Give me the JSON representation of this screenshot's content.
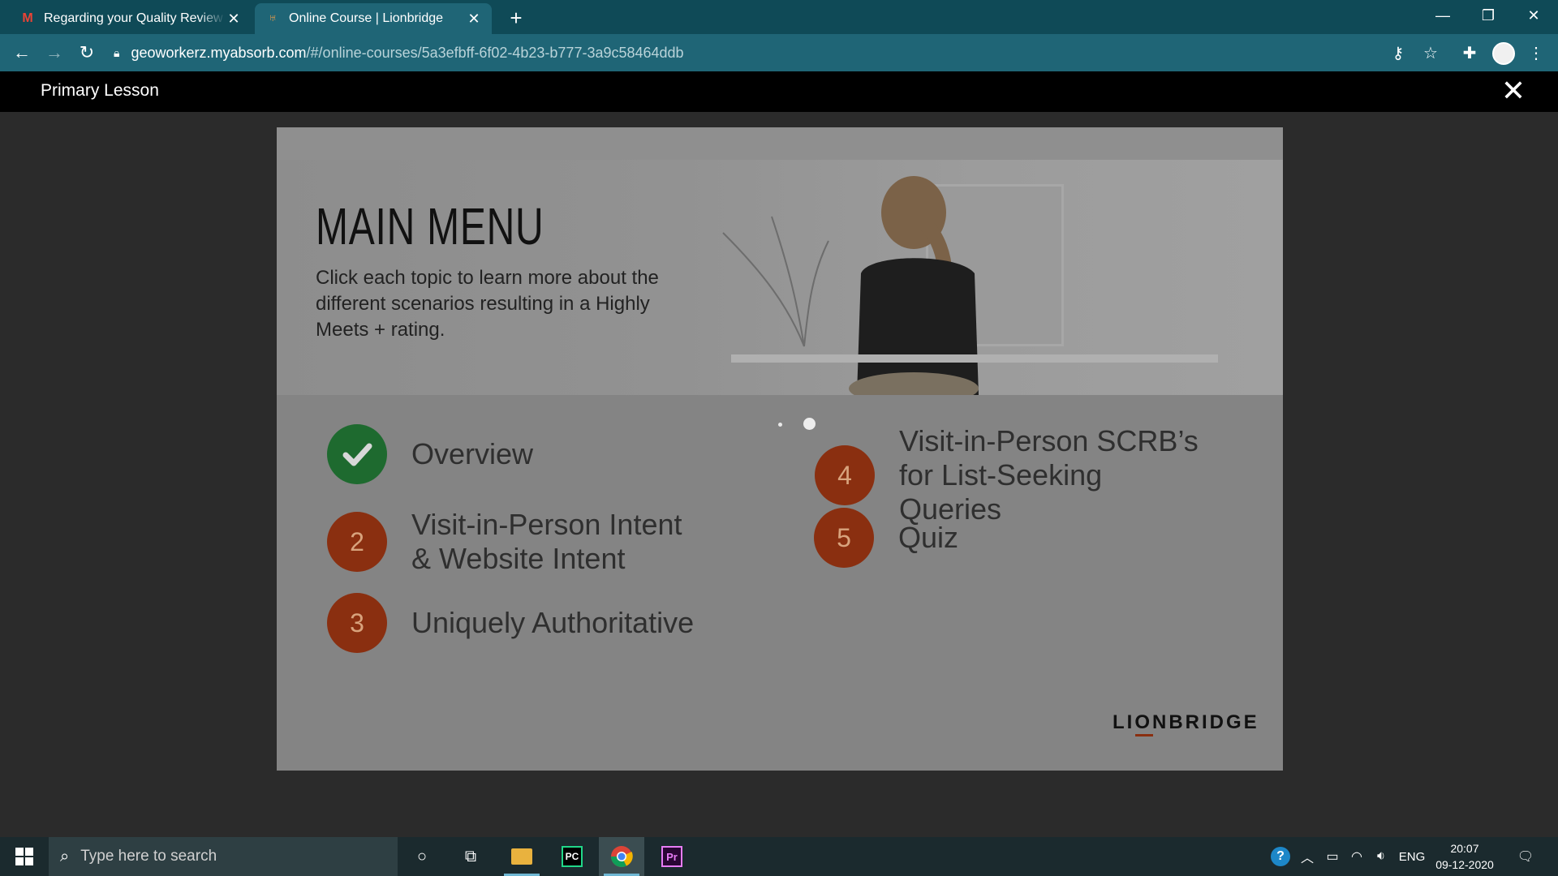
{
  "browser": {
    "tabs": [
      {
        "title": "Regarding your Quality Review a",
        "active": false,
        "favicon": "gmail-icon"
      },
      {
        "title": "Online Course | Lionbridge",
        "active": true,
        "favicon": "absorb-icon"
      }
    ],
    "url_host": "geoworkerz.myabsorb.com",
    "url_path": "/#/online-courses/5a3efbff-6f02-4b23-b777-3a9c58464ddb"
  },
  "lesson": {
    "title": "Primary Lesson"
  },
  "slide": {
    "title": "MAIN MENU",
    "subtitle": "Click each topic to learn more about the different scenarios resulting in a Highly Meets + rating.",
    "topics": [
      {
        "number": "",
        "status": "completed",
        "label": "Overview"
      },
      {
        "number": "2",
        "status": "pending",
        "label": "Visit-in-Person Intent & Website Intent"
      },
      {
        "number": "3",
        "status": "pending",
        "label": "Uniquely Authoritative"
      },
      {
        "number": "4",
        "status": "pending",
        "label": "Visit-in-Person SCRB’s for List-Seeking Queries"
      },
      {
        "number": "5",
        "status": "pending",
        "label": "Quiz"
      }
    ],
    "logo": "LIONBRIDGE"
  },
  "taskbar": {
    "search_placeholder": "Type here to search",
    "language": "ENG",
    "time": "20:07",
    "date": "09-12-2020"
  }
}
